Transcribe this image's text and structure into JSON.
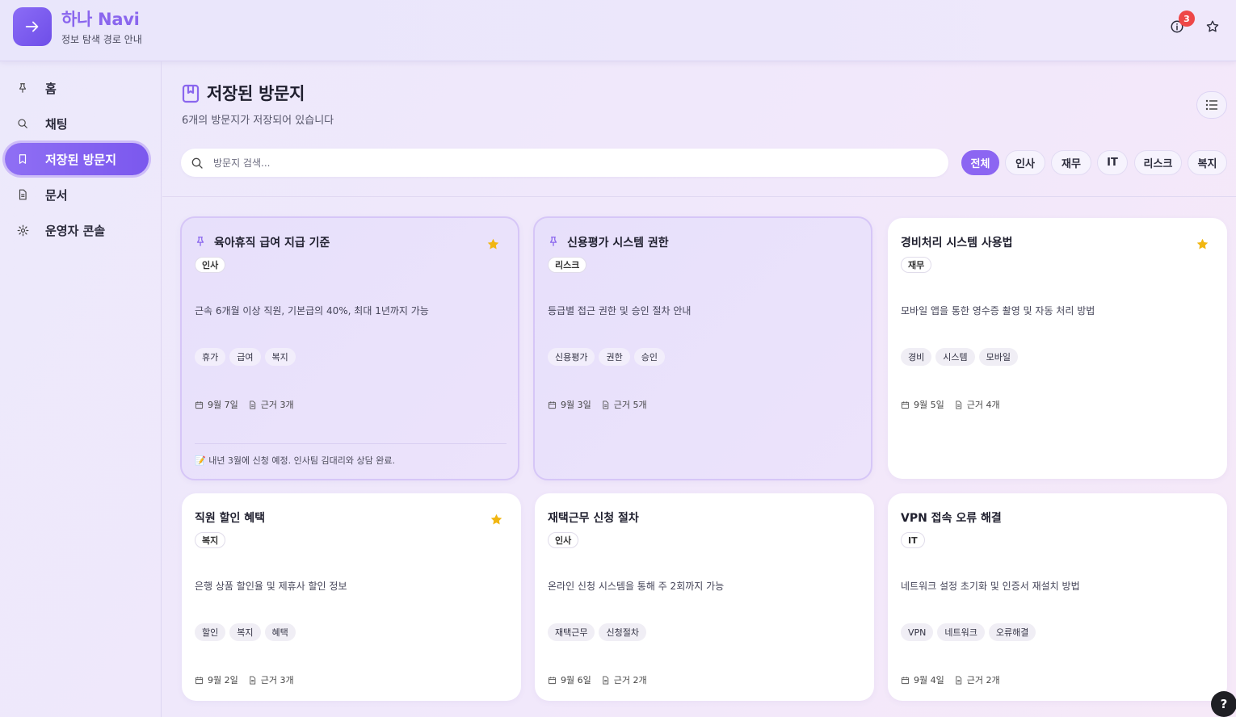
{
  "app": {
    "name": "하나 Navi",
    "tagline": "정보 탐색 경로 안내",
    "notification_count": "3",
    "help_label": "?",
    "accent_color": "#8c66f2"
  },
  "sidebar": {
    "items": [
      {
        "label": "홈",
        "icon": "pin-icon",
        "active": false
      },
      {
        "label": "채팅",
        "icon": "search-icon",
        "active": false
      },
      {
        "label": "저장된 방문지",
        "icon": "bookmark-icon",
        "active": true
      },
      {
        "label": "문서",
        "icon": "document-icon",
        "active": false
      },
      {
        "label": "운영자 콘솔",
        "icon": "gear-icon",
        "active": false
      }
    ]
  },
  "main": {
    "title": "저장된 방문지",
    "subtitle": "6개의 방문지가 저장되어 있습니다",
    "search_placeholder": "방문지 검색...",
    "filters": [
      "전체",
      "인사",
      "재무",
      "IT",
      "리스크",
      "복지"
    ],
    "active_filter": "전체"
  },
  "cards": [
    {
      "title": "육아휴직 급여 지급 기준",
      "pinned": true,
      "starred": true,
      "category": "인사",
      "description": "근속 6개월 이상 직원, 기본급의 40%, 최대 1년까지 가능",
      "tags": [
        "휴가",
        "급여",
        "복지"
      ],
      "date": "9월 7일",
      "sources": "근거 3개",
      "note": "📝 내년 3월에 신청 예정. 인사팀 김대리와 상담 완료."
    },
    {
      "title": "신용평가 시스템 권한",
      "pinned": true,
      "starred": false,
      "category": "리스크",
      "description": "등급별 접근 권한 및 승인 절차 안내",
      "tags": [
        "신용평가",
        "권한",
        "승인"
      ],
      "date": "9월 3일",
      "sources": "근거 5개"
    },
    {
      "title": "경비처리 시스템 사용법",
      "pinned": false,
      "starred": true,
      "category": "재무",
      "description": "모바일 앱을 통한 영수증 촬영 및 자동 처리 방법",
      "tags": [
        "경비",
        "시스템",
        "모바일"
      ],
      "date": "9월 5일",
      "sources": "근거 4개"
    },
    {
      "title": "직원 할인 혜택",
      "pinned": false,
      "starred": true,
      "category": "복지",
      "description": "은행 상품 할인율 및 제휴사 할인 정보",
      "tags": [
        "할인",
        "복지",
        "혜택"
      ],
      "date": "9월 2일",
      "sources": "근거 3개"
    },
    {
      "title": "재택근무 신청 절차",
      "pinned": false,
      "starred": false,
      "category": "인사",
      "description": "온라인 신청 시스템을 통해 주 2회까지 가능",
      "tags": [
        "재택근무",
        "신청절차"
      ],
      "date": "9월 6일",
      "sources": "근거 2개"
    },
    {
      "title": "VPN 접속 오류 해결",
      "pinned": false,
      "starred": false,
      "category": "IT",
      "description": "네트워크 설정 초기화 및 인증서 재설치 방법",
      "tags": [
        "VPN",
        "네트워크",
        "오류해결"
      ],
      "date": "9월 4일",
      "sources": "근거 2개"
    }
  ]
}
